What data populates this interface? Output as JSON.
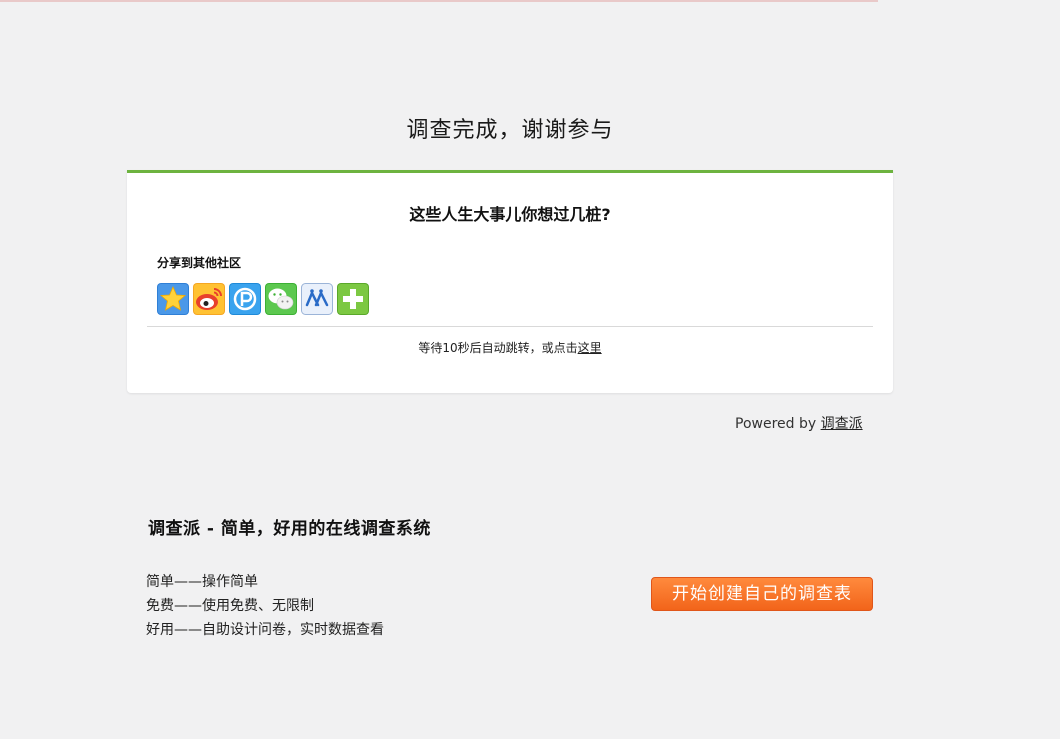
{
  "header": {
    "title": "调查完成，谢谢参与"
  },
  "card": {
    "title": "这些人生大事儿你想过几桩?",
    "share_label": "分享到其他社区",
    "share_icons": [
      {
        "icon": "qzone-icon",
        "color": "#2f7fd6"
      },
      {
        "icon": "weibo-icon",
        "color": "#e8402c"
      },
      {
        "icon": "pengyou-icon",
        "color": "#1f8ad8"
      },
      {
        "icon": "wechat-icon",
        "color": "#3cb034"
      },
      {
        "icon": "renren-icon",
        "color": "#2a6bc7"
      },
      {
        "icon": "more-share-icon",
        "color": "#6cbf2f"
      }
    ],
    "redirect_text": "等待10秒后自动跳转，或点击",
    "redirect_link": "这里"
  },
  "footer": {
    "powered_prefix": "Powered by ",
    "powered_link": "调查派"
  },
  "promo": {
    "title": "调查派 - 简单，好用的在线调查系统",
    "features": [
      "简单——操作简单",
      "免费——使用免费、无限制",
      "好用——自助设计问卷，实时数据查看"
    ],
    "cta_label": "开始创建自己的调查表"
  }
}
